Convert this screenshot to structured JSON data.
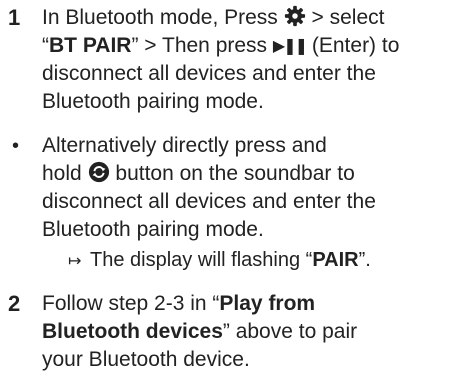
{
  "steps": [
    {
      "marker": "1",
      "t1": "In Bluetooth mode, Press",
      "t2": "> select",
      "q_open": "“",
      "bt_pair": "BT PAIR",
      "q_close": "” > Then press",
      "enter_glyph": "▶❚❚",
      "t3": "(Enter) to",
      "line2": "disconnect all devices and enter the",
      "line3": "Bluetooth pairing mode."
    },
    {
      "marker": "•",
      "line1": "Alternatively directly press and",
      "t_hold": "hold",
      "t_button": "button on the soundbar to",
      "line3": "disconnect all devices and enter the",
      "line4": "Bluetooth pairing mode.",
      "sub_arrow": "↦",
      "sub_text": "The display will flashing “",
      "sub_bold": "PAIR",
      "sub_end": "”."
    },
    {
      "marker": "2",
      "t1": "Follow step 2-3 in “",
      "bold1": "Play from",
      "bold2": "Bluetooth devices",
      "t2": "” above to pair",
      "line3": "your Bluetooth device."
    }
  ],
  "icons": {
    "settings": "gear-icon",
    "play_pause": "play-pause-icon",
    "pair": "pair-button-icon"
  }
}
